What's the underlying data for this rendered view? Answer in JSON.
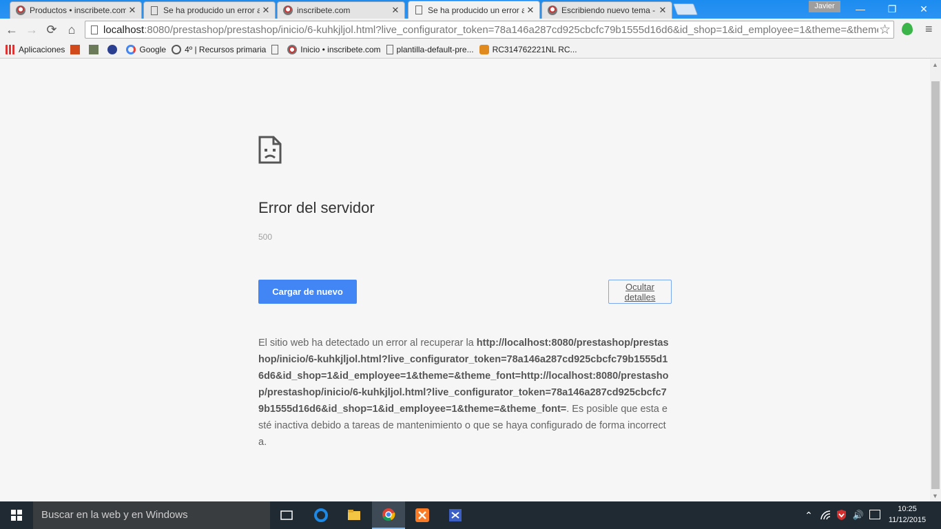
{
  "browser": {
    "tabs": [
      {
        "title": "Productos • inscribete.com",
        "icon": "site-favicon"
      },
      {
        "title": "Se ha producido un error al",
        "icon": "document-icon"
      },
      {
        "title": "inscribete.com",
        "icon": "site-favicon"
      },
      {
        "title": "Se ha producido un error al",
        "icon": "document-icon",
        "active": true
      },
      {
        "title": "Escribiendo nuevo tema - ",
        "icon": "site-favicon"
      }
    ],
    "close_glyph": "✕",
    "profile_name": "Javier",
    "window_controls": {
      "minimize": "—",
      "restore": "❐",
      "close": "✕"
    },
    "url_host": "localhost",
    "url_rest": ":8080/prestashop/prestashop/inicio/6-kuhkjljol.html?live_configurator_token=78a146a287cd925cbcfc79b1555d16d6&id_shop=1&id_employee=1&theme=&theme_font=",
    "nav": {
      "back": "←",
      "forward": "→",
      "reload": "⟳",
      "home": "⌂",
      "star": "☆",
      "menu": "≡"
    },
    "bookmarks": [
      {
        "label": "Aplicaciones",
        "icon": "apps-icon"
      },
      {
        "label": "",
        "icon": "bookmark-1-icon"
      },
      {
        "label": "",
        "icon": "bookmark-2-icon"
      },
      {
        "label": "",
        "icon": "bookmark-3-icon"
      },
      {
        "label": "Google",
        "icon": "google-icon"
      },
      {
        "label": "4º | Recursos primaria",
        "icon": "wordpress-icon"
      },
      {
        "label": "",
        "icon": "document-icon"
      },
      {
        "label": "Inicio • inscribete.com",
        "icon": "site-favicon"
      },
      {
        "label": "plantilla-default-pre...",
        "icon": "document-icon"
      },
      {
        "label": "RC314762221NL RC...",
        "icon": "postal-icon"
      }
    ]
  },
  "error_page": {
    "title": "Error del servidor",
    "code": "500",
    "reload_label": "Cargar de nuevo",
    "details_label": "Ocultar detalles",
    "details_prefix": "El sitio web ha detectado un error al recuperar la ",
    "details_url_1": "http://localhost:8080/prestashop/prestashop/inicio/6-kuhkjljol.html?live_configurator_token=78a146a287cd925cbcfc79b1555d16d6&id_shop=1&id_employee=1&theme=&theme_font=",
    "details_url_2": "http://localhost:8080/prestashop/prestashop/inicio/6-kuhkjljol.html?live_configurator_token=78a146a287cd925cbcfc79b1555d16d6&id_shop=1&id_employee=1&theme=&theme_font=",
    "details_suffix": ". Es posible que esta esté inactiva debido a tareas de mantenimiento o que se haya configurado de forma incorrecta."
  },
  "taskbar": {
    "search_placeholder": "Buscar en la web y en Windows",
    "apps": [
      "task-view-icon",
      "edge-icon",
      "file-explorer-icon",
      "chrome-icon",
      "xampp-icon",
      "app-icon"
    ],
    "tray": {
      "chevron": "⌃",
      "volume": "🔊"
    },
    "time": "10:25",
    "date": "11/12/2015"
  },
  "colors": {
    "reload_button": "#4285f4",
    "tabstrip": "#1c8cf0",
    "taskbar": "#1f2a33"
  }
}
